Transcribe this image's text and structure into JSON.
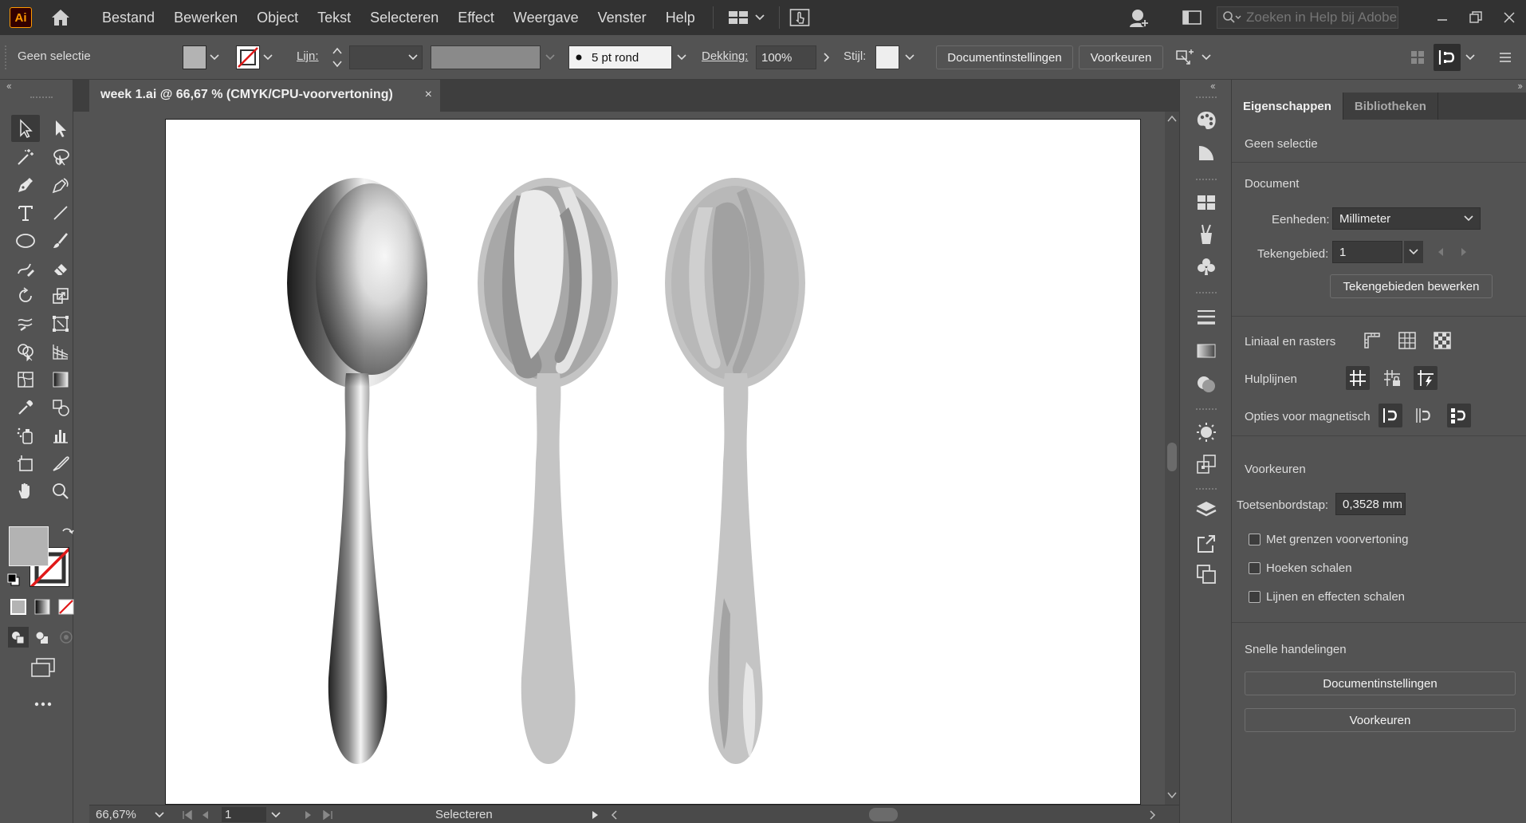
{
  "app": {
    "logo": "Ai",
    "brand_color": "#ff9a00"
  },
  "menu": [
    "Bestand",
    "Bewerken",
    "Object",
    "Tekst",
    "Selecteren",
    "Effect",
    "Weergave",
    "Venster",
    "Help"
  ],
  "search": {
    "placeholder": "Zoeken in Help bij Adobe"
  },
  "control_bar": {
    "selection_status": "Geen selectie",
    "stroke_label": "Lijn:",
    "brush": "5 pt rond",
    "opacity_label": "Dekking:",
    "opacity_value": "100%",
    "style_label": "Stijl:",
    "doc_settings_button": "Documentinstellingen",
    "preferences_button": "Voorkeuren"
  },
  "document": {
    "tab_title": "week 1.ai @ 66,67 % (CMYK/CPU-voorvertoning)",
    "close": "×"
  },
  "status_bar": {
    "zoom": "66,67%",
    "artboard_number": "1",
    "tool": "Selecteren"
  },
  "properties": {
    "tabs": [
      "Eigenschappen",
      "Bibliotheken"
    ],
    "selection": "Geen selectie",
    "document_heading": "Document",
    "units_label": "Eenheden:",
    "units_value": "Millimeter",
    "artboard_label": "Tekengebied:",
    "artboard_value": "1",
    "edit_artboards_button": "Tekengebieden bewerken",
    "rulers_label": "Liniaal en rasters",
    "guides_label": "Hulplijnen",
    "snap_label": "Opties voor magnetisch",
    "prefs_heading": "Voorkeuren",
    "keyboard_increment_label": "Toetsenbordstap:",
    "keyboard_increment_value": "0,3528 mm",
    "checkboxes": [
      "Met grenzen voorvertoning",
      "Hoeken schalen",
      "Lijnen en effecten schalen"
    ],
    "quick_actions_heading": "Snelle handelingen",
    "quick_doc_settings": "Documentinstellingen",
    "quick_preferences": "Voorkeuren"
  },
  "icons": {
    "home": "home-icon",
    "workspace": "workspace-grid-icon",
    "publish": "touch-icon",
    "user": "user-icon",
    "search": "search-icon"
  },
  "colors": {
    "fill": "#b3b3b3",
    "ui_dark": "#323232",
    "ui_mid": "#535353",
    "stroke_none": "#e01919"
  }
}
